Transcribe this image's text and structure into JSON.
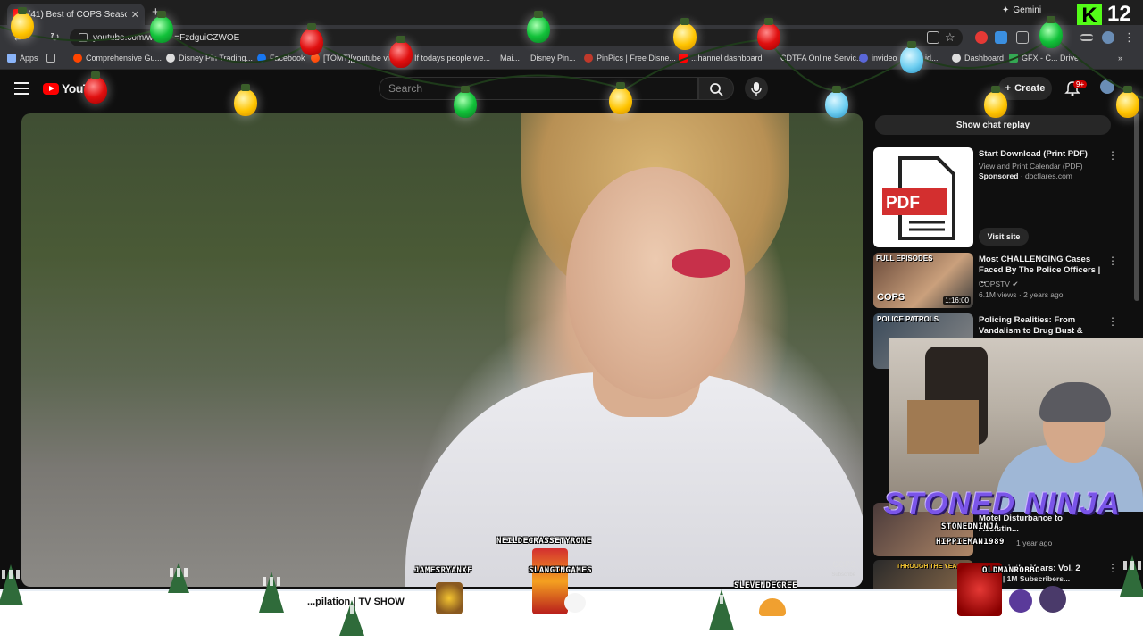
{
  "browser": {
    "tab_title": "(41) Best of COPS Season 1",
    "new_tab": "+",
    "gemini_label": "Gemini",
    "url": "youtube.com/w",
    "url_suffix": "=FzdguiCZWOE",
    "bookmarks": [
      "Apps",
      "Comprehensive Gu...",
      "Disney Pin Trading...",
      "Facebook",
      "[TOMT][youtube vid...",
      "If todays people we...",
      "Mai...",
      "Disney Pin...",
      "PinPics | Free Disne...",
      "...hannel dashboard",
      "CDTFA Online Servic...",
      "invideo",
      "id...",
      "Dashboard",
      "GFX - C... Drive"
    ]
  },
  "youtube": {
    "logo_text": "YouT",
    "search_placeholder": "Search",
    "create_label": "Create",
    "notif_count": "9+"
  },
  "sidebar": {
    "chat_replay": "Show chat replay",
    "ad": {
      "title": "Start Download (Print PDF)",
      "subtitle": "View and Print Calendar (PDF)",
      "sponsored": "Sponsored",
      "domain": "docflares.com",
      "thumb_label": "PDF",
      "visit_label": "Visit site"
    },
    "videos": [
      {
        "thumb_tag": "FULL EPISODES",
        "thumb_brand": "COPS",
        "duration": "1:16:00",
        "title": "Most CHALLENGING Cases Faced By The Police Officers | ...",
        "channel": "COPSTV",
        "meta": "6.1M views · 2 years ago"
      },
      {
        "thumb_tag": "POLICE PATROLS",
        "title": "Policing Realities: From Vandalism to Drug Bust & Hig..."
      },
      {
        "title": "Motel Disturbance to Assistin...",
        "meta": "1 year ago"
      },
      {
        "thumb_tag": "THROUGH THE YEARS",
        "title": "Through the Years: Vol. 2",
        "meta": "-2020) | 1M Subscribers..."
      }
    ]
  },
  "overlay": {
    "streamer_name": "STONED NINJA",
    "kick_count": "12",
    "kick_logo": "K",
    "chat_names": [
      "NEILDEGRASSETYRONE",
      "JAMESRYANXF",
      "SLANGINGAMES",
      "SLEVENDEGREE",
      "STONEDNINJA",
      "HIPPIEMAN1989",
      "OLDMANROBBO"
    ],
    "video_watermark": "COPS",
    "subscribe_watermark": "Subscribe",
    "footer_text": "...pilation | TV SHOW"
  },
  "colors": {
    "yt_red": "#ff0000",
    "bg": "#0f0f0f",
    "kick_green": "#53fc18",
    "ninja_purple": "#7a55e8"
  }
}
